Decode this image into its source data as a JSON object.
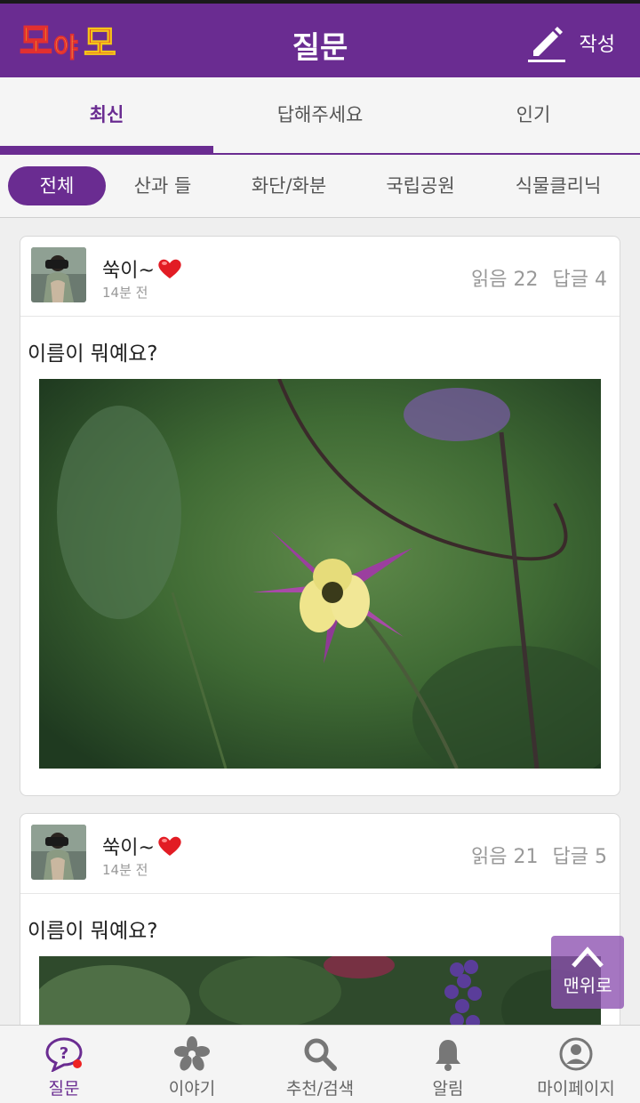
{
  "header": {
    "logo_text": "모야모",
    "title": "질문",
    "write_label": "작성",
    "write_icon": "pencil-icon"
  },
  "tabs": [
    {
      "label": "최신",
      "active": true
    },
    {
      "label": "답해주세요",
      "active": false
    },
    {
      "label": "인기",
      "active": false
    }
  ],
  "categories": [
    {
      "label": "전체",
      "active": true
    },
    {
      "label": "산과 들",
      "active": false
    },
    {
      "label": "화단/화분",
      "active": false
    },
    {
      "label": "국립공원",
      "active": false
    },
    {
      "label": "식물클리닉",
      "active": false
    }
  ],
  "posts": [
    {
      "author": "쑥이~",
      "time": "14분 전",
      "reads": "읽음 22",
      "replies": "답글 4",
      "title": "이름이 뭐예요?"
    },
    {
      "author": "쑥이~",
      "time": "14분 전",
      "reads": "읽음 21",
      "replies": "답글 5",
      "title": "이름이 뭐예요?"
    }
  ],
  "scroll_top_label": "맨위로",
  "bottom_nav": [
    {
      "label": "질문",
      "icon": "question-bubble-icon",
      "active": true
    },
    {
      "label": "이야기",
      "icon": "flower-icon",
      "active": false
    },
    {
      "label": "추천/검색",
      "icon": "search-icon",
      "active": false
    },
    {
      "label": "알림",
      "icon": "bell-icon",
      "active": false
    },
    {
      "label": "마이페이지",
      "icon": "profile-icon",
      "active": false
    }
  ],
  "colors": {
    "brand": "#6a2c91",
    "badge": "#e22222"
  }
}
